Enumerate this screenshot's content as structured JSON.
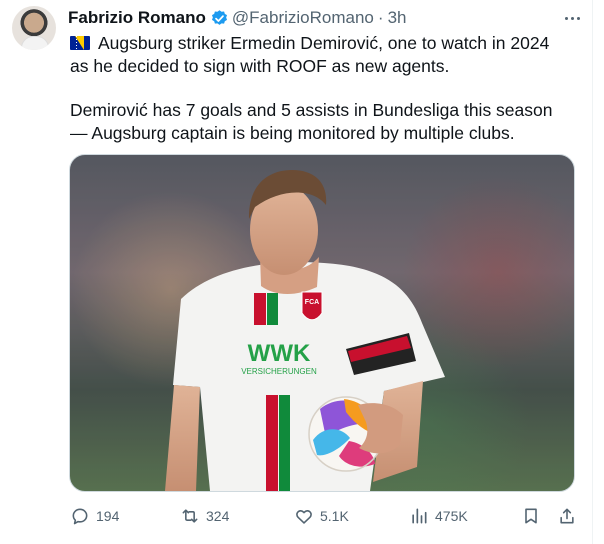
{
  "tweet": {
    "author_name": "Fabrizio Romano",
    "handle": "@FabrizioRomano",
    "separator": "·",
    "time": "3h",
    "line1": "Augsburg striker Ermedin Demirović, one to watch in 2024",
    "line2": "as he decided to sign with ROOF as new agents.",
    "line3": "Demirović has 7 goals and 5 assists in Bundesliga this season",
    "line4": "— Augsburg captain is being monitored by multiple clubs.",
    "media": {
      "jersey_sponsor": "WWK",
      "jersey_sponsor_sub": "VERSICHERUNGEN",
      "crest_text": "FCA"
    }
  },
  "actions": {
    "replies": "194",
    "reposts": "324",
    "likes": "5.1K",
    "views": "475K"
  },
  "colors": {
    "verified": "#1d9bf0",
    "text": "#0f1419",
    "secondary": "#536471"
  },
  "icons": [
    "verified-badge-icon",
    "more-icon",
    "bosnia-flag-icon",
    "reply-icon",
    "repost-icon",
    "like-icon",
    "views-icon",
    "bookmark-icon",
    "share-icon"
  ]
}
